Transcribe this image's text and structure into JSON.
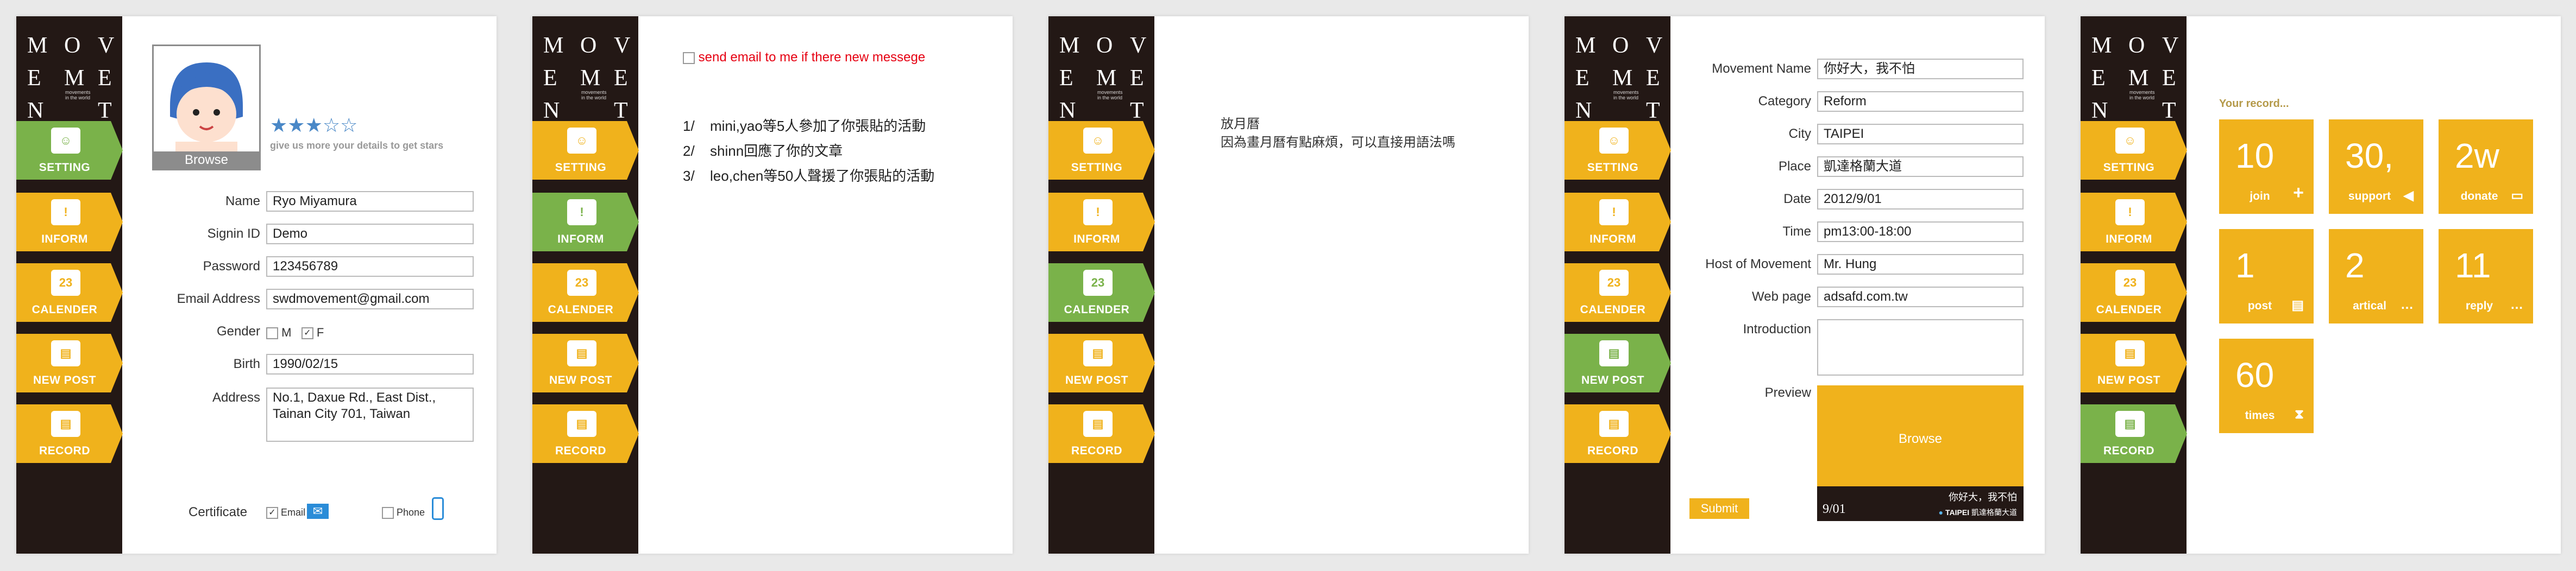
{
  "brand": {
    "letters": [
      "M",
      "O",
      "V",
      "E",
      "M",
      "E",
      "N",
      "T"
    ],
    "tagline1": "movements",
    "tagline2": "in the world"
  },
  "nav": [
    {
      "key": "setting",
      "label": "SETTING",
      "icon": "avatar-icon"
    },
    {
      "key": "inform",
      "label": "INFORM",
      "icon": "exclamation-icon"
    },
    {
      "key": "calender",
      "label": "CALENDER",
      "icon": "calendar-icon",
      "icon_text": "23"
    },
    {
      "key": "newpost",
      "label": "NEW POST",
      "icon": "post-icon"
    },
    {
      "key": "record",
      "label": "RECORD",
      "icon": "record-icon"
    }
  ],
  "colors": {
    "accent": "#f0b21c",
    "active": "#7ab24a",
    "sidebar": "#231815",
    "star": "#4a88c7",
    "link_red": "#e60012"
  },
  "setting": {
    "browse_label": "Browse",
    "stars_filled": 3,
    "stars_total": 5,
    "stars_hint": "give us more your details to get stars",
    "fields": [
      {
        "label": "Name",
        "value": "Ryo Miyamura"
      },
      {
        "label": "Signin ID",
        "value": "Demo"
      },
      {
        "label": "Password",
        "value": "123456789"
      },
      {
        "label": "Email Address",
        "value": "swdmovement@gmail.com"
      }
    ],
    "gender_label": "Gender",
    "gender_m": "M",
    "gender_f": "F",
    "birth_label": "Birth",
    "birth_value": "1990/02/15",
    "address_label": "Address",
    "address_value": "No.1, Daxue Rd., East Dist.,\nTainan City 701, Taiwan",
    "certificate_label": "Certificate",
    "cert_email": "Email",
    "cert_phone": "Phone"
  },
  "inform": {
    "email_option": "send email to me if there new messege",
    "items": [
      {
        "n": "1/",
        "text": "mini,yao等5人參加了你張貼的活動"
      },
      {
        "n": "2/",
        "text": "shinn回應了你的文章"
      },
      {
        "n": "3/",
        "text": "leo,chen等50人聲援了你張貼的活動"
      }
    ]
  },
  "calender": {
    "line1": "放月曆",
    "line2": "因為畫月曆有點麻煩，可以直接用語法嗎"
  },
  "newpost": {
    "fields": [
      {
        "label": "Movement Name",
        "value": "你好大，我不怕"
      },
      {
        "label": "Category",
        "value": "Reform"
      },
      {
        "label": "City",
        "value": "TAIPEI"
      },
      {
        "label": "Place",
        "value": "凱達格蘭大道"
      },
      {
        "label": "Date",
        "value": "2012/9/01"
      },
      {
        "label": "Time",
        "value": "pm13:00-18:00"
      },
      {
        "label": "Host of Movement",
        "value": "Mr. Hung"
      },
      {
        "label": "Web page",
        "value": "adsafd.com.tw"
      }
    ],
    "intro_label": "Introduction",
    "preview_label": "Preview",
    "preview_browse": "Browse",
    "preview_title": "你好大，我不怕",
    "preview_date": "9/01",
    "preview_city": "TAIPEI",
    "preview_place": "凱達格蘭大道",
    "submit_label": "Submit"
  },
  "record": {
    "heading": "Your record...",
    "tiles": [
      {
        "num": "10",
        "cap": "join",
        "icon": "plus-icon",
        "glyph": "+"
      },
      {
        "num": "30,",
        "cap": "support",
        "icon": "megaphone-icon",
        "glyph": "◀"
      },
      {
        "num": "2w",
        "cap": "donate",
        "icon": "money-icon",
        "glyph": "▭"
      },
      {
        "num": "1",
        "cap": "post",
        "icon": "document-icon",
        "glyph": "▤"
      },
      {
        "num": "2",
        "cap": "artical",
        "icon": "speech-bubble-icon",
        "glyph": "…"
      },
      {
        "num": "11",
        "cap": "reply",
        "icon": "speech-bubble-icon",
        "glyph": "…"
      },
      {
        "num": "60",
        "cap": "times",
        "icon": "hourglass-icon",
        "glyph": "⧗"
      }
    ]
  }
}
